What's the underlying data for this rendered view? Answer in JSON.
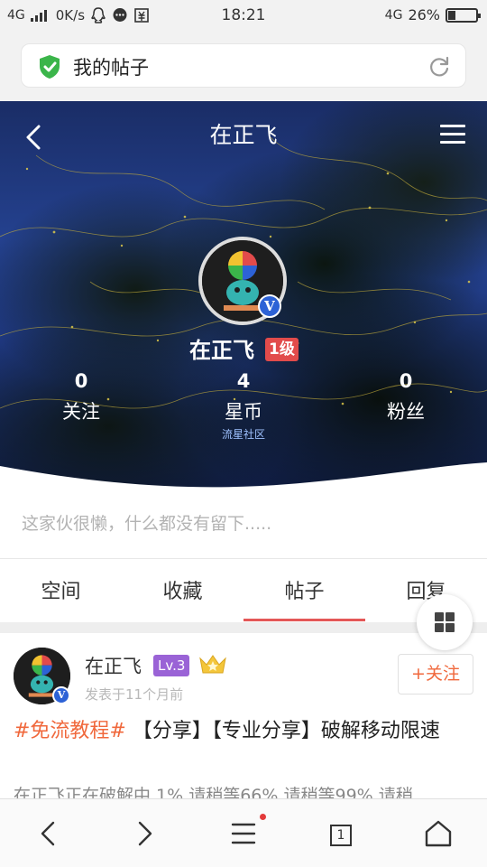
{
  "status_bar": {
    "network_left": "4G",
    "speed": "0K/s",
    "time": "18:21",
    "network_right": "4G",
    "battery": "26%",
    "battery_level": 0.26
  },
  "browser": {
    "page_title": "我的帖子"
  },
  "profile": {
    "header_title": "在正飞",
    "name": "在正飞",
    "level": "1级",
    "stats": [
      {
        "value": "0",
        "label": "关注"
      },
      {
        "value": "4",
        "label": "星币",
        "sub": "流星社区"
      },
      {
        "value": "0",
        "label": "粉丝"
      }
    ],
    "bio": "这家伙很懒，什么都没有留下....."
  },
  "tabs": [
    {
      "label": "空间"
    },
    {
      "label": "收藏"
    },
    {
      "label": "帖子",
      "active": true
    },
    {
      "label": "回复"
    }
  ],
  "post": {
    "author": "在正飞",
    "level": "Lv.3",
    "time": "发表于11个月前",
    "follow": "+关注",
    "tag": "#免流教程#",
    "title": "【分享】【专业分享】破解移动限速",
    "excerpt": "在正飞正在破解中 1% 请稍等66% 请稍等99% 请稍"
  },
  "bottom_nav": {
    "tab_count": "1"
  },
  "colors": {
    "accent": "#e45757",
    "orange": "#f0683c",
    "level_badge": "#e24b4b",
    "lv_badge": "#9a63d6"
  }
}
